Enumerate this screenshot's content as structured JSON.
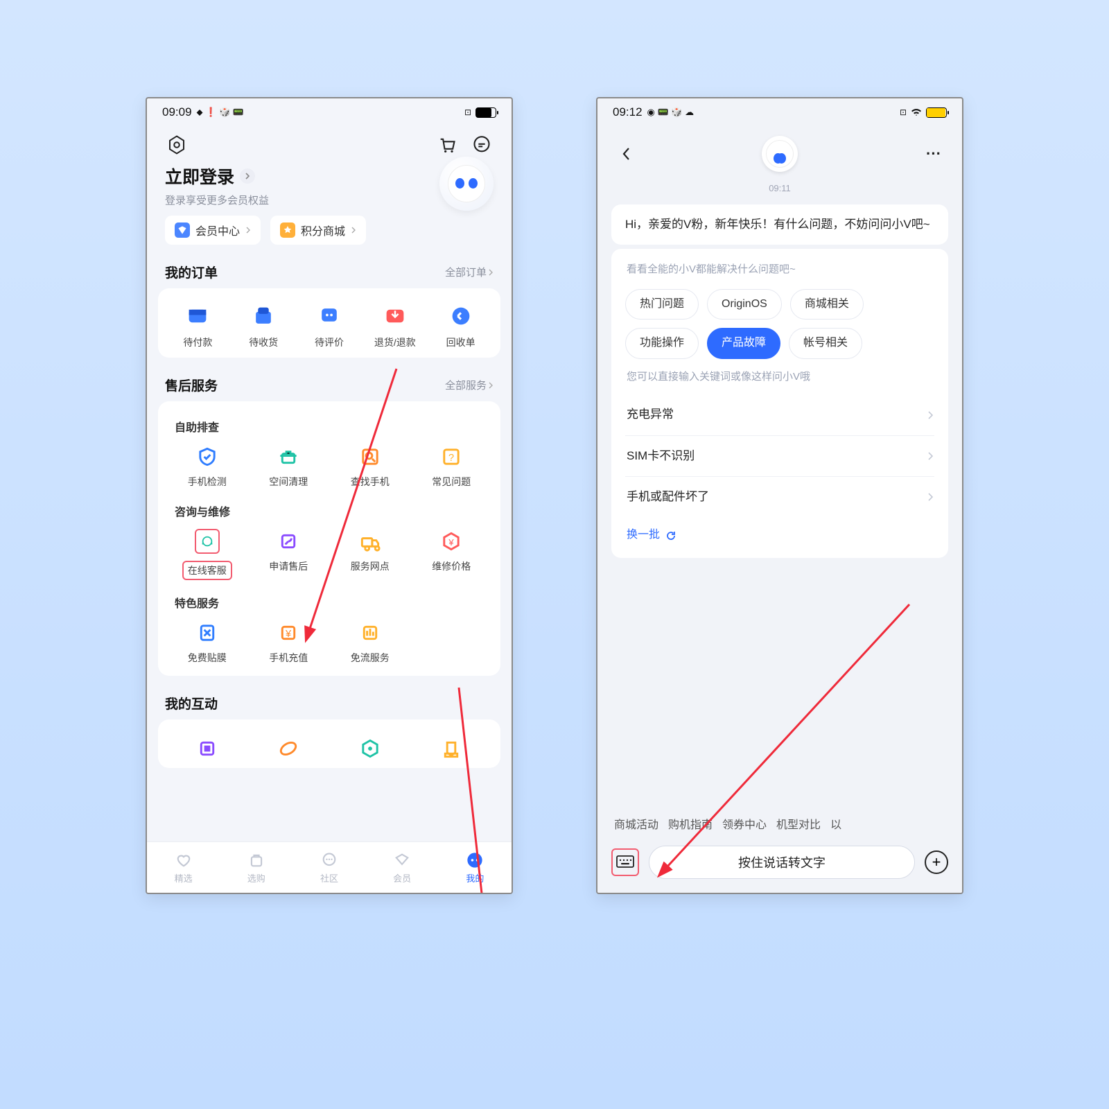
{
  "left": {
    "status_time": "09:09",
    "login_title": "立即登录",
    "login_subtitle": "登录享受更多会员权益",
    "chips": [
      "会员中心",
      "积分商城"
    ],
    "orders_title": "我的订单",
    "orders_link": "全部订单",
    "orders": [
      {
        "label": "待付款",
        "color": "#3c7eff"
      },
      {
        "label": "待收货",
        "color": "#3c7eff"
      },
      {
        "label": "待评价",
        "color": "#3c7eff"
      },
      {
        "label": "退货/退款",
        "color": "#ff5a5a"
      },
      {
        "label": "回收单",
        "color": "#3c7eff"
      }
    ],
    "service_title": "售后服务",
    "service_link": "全部服务",
    "svc_group1_title": "自助排查",
    "svc_group1": [
      {
        "label": "手机检测",
        "color": "#2f7dff"
      },
      {
        "label": "空间清理",
        "color": "#1fc3a6"
      },
      {
        "label": "查找手机",
        "color": "#ff8a2b"
      },
      {
        "label": "常见问题",
        "color": "#ffb12b"
      }
    ],
    "svc_group2_title": "咨询与维修",
    "svc_group2": [
      {
        "label": "在线客服",
        "color": "#1fc3a6",
        "hl": true
      },
      {
        "label": "申请售后",
        "color": "#8a4bff"
      },
      {
        "label": "服务网点",
        "color": "#ffb12b"
      },
      {
        "label": "维修价格",
        "color": "#ff5a5a"
      }
    ],
    "svc_group3_title": "特色服务",
    "svc_group3": [
      {
        "label": "免费贴膜",
        "color": "#2f7dff"
      },
      {
        "label": "手机充值",
        "color": "#ff8a2b"
      },
      {
        "label": "免流服务",
        "color": "#ffb12b"
      }
    ],
    "interact_title": "我的互动",
    "interact": [
      {
        "color": "#8a4bff"
      },
      {
        "color": "#ff8a2b"
      },
      {
        "color": "#1fc3a6"
      },
      {
        "color": "#ffb12b"
      }
    ],
    "tabs": [
      {
        "label": "精选"
      },
      {
        "label": "选购"
      },
      {
        "label": "社区"
      },
      {
        "label": "会员"
      },
      {
        "label": "我的",
        "active": true
      }
    ]
  },
  "right": {
    "status_time": "09:12",
    "timestamp": "09:11",
    "greeting": "Hi，亲爱的V粉，新年快乐！有什么问题，不妨问问小V吧~",
    "prompt_hint": "看看全能的小V都能解决什么问题吧~",
    "topics": [
      {
        "label": "热门问题"
      },
      {
        "label": "OriginOS"
      },
      {
        "label": "商城相关"
      },
      {
        "label": "功能操作"
      },
      {
        "label": "产品故障",
        "selected": true
      },
      {
        "label": "帐号相关"
      }
    ],
    "input_hint": "您可以直接输入关键词或像这样问小V哦",
    "questions": [
      "充电异常",
      "SIM卡不识别",
      "手机或配件坏了"
    ],
    "refresh": "换一批",
    "quick": [
      "商城活动",
      "购机指南",
      "领券中心",
      "机型对比",
      "以"
    ],
    "voice_text": "按住说话转文字"
  }
}
